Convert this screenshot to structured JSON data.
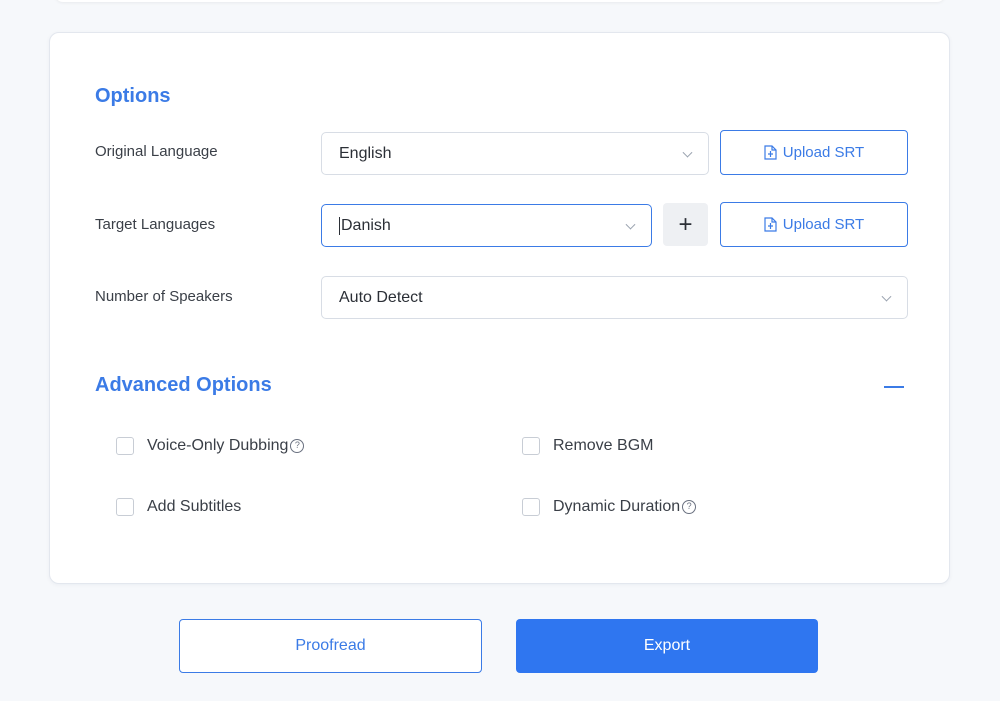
{
  "options": {
    "title": "Options",
    "original_language": {
      "label": "Original Language",
      "value": "English",
      "upload_label": "Upload SRT"
    },
    "target_languages": {
      "label": "Target Languages",
      "value": "Danish",
      "add_symbol": "+",
      "upload_label": "Upload SRT"
    },
    "speakers": {
      "label": "Number of Speakers",
      "value": "Auto Detect"
    }
  },
  "advanced": {
    "title": "Advanced Options",
    "checkboxes": [
      {
        "label": "Voice-Only Dubbing",
        "checked": false,
        "help": true
      },
      {
        "label": "Remove BGM",
        "checked": false,
        "help": false
      },
      {
        "label": "Add Subtitles",
        "checked": false,
        "help": false
      },
      {
        "label": "Dynamic Duration",
        "checked": false,
        "help": true
      }
    ],
    "help_symbol": "?"
  },
  "actions": {
    "proofread": "Proofread",
    "export": "Export"
  },
  "colors": {
    "accent": "#3b7be6",
    "primary_button": "#2f76f0"
  }
}
